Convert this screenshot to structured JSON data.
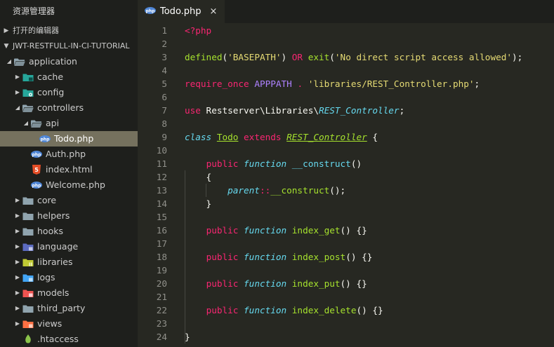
{
  "sidebar": {
    "header": "资源管理器",
    "open_editors": "打开的编辑器",
    "project": "JWT-RESTFULL-IN-CI-TUTORIAL",
    "tree": [
      {
        "label": "application",
        "depth": 1,
        "chevron": "down",
        "icon": "folder-open-icon"
      },
      {
        "label": "cache",
        "depth": 2,
        "chevron": "right",
        "icon": "folder-cache-icon"
      },
      {
        "label": "config",
        "depth": 2,
        "chevron": "right",
        "icon": "folder-config-icon"
      },
      {
        "label": "controllers",
        "depth": 2,
        "chevron": "down",
        "icon": "folder-open-icon"
      },
      {
        "label": "api",
        "depth": 3,
        "chevron": "down",
        "icon": "folder-open-icon"
      },
      {
        "label": "Todo.php",
        "depth": 4,
        "chevron": "none",
        "icon": "php-file-icon",
        "selected": true
      },
      {
        "label": "Auth.php",
        "depth": 3,
        "chevron": "none",
        "icon": "php-file-icon"
      },
      {
        "label": "index.html",
        "depth": 3,
        "chevron": "none",
        "icon": "html-file-icon"
      },
      {
        "label": "Welcome.php",
        "depth": 3,
        "chevron": "none",
        "icon": "php-file-icon"
      },
      {
        "label": "core",
        "depth": 2,
        "chevron": "right",
        "icon": "folder-icon"
      },
      {
        "label": "helpers",
        "depth": 2,
        "chevron": "right",
        "icon": "folder-icon"
      },
      {
        "label": "hooks",
        "depth": 2,
        "chevron": "right",
        "icon": "folder-icon"
      },
      {
        "label": "language",
        "depth": 2,
        "chevron": "right",
        "icon": "folder-language-icon"
      },
      {
        "label": "libraries",
        "depth": 2,
        "chevron": "right",
        "icon": "folder-libraries-icon"
      },
      {
        "label": "logs",
        "depth": 2,
        "chevron": "right",
        "icon": "folder-logs-icon"
      },
      {
        "label": "models",
        "depth": 2,
        "chevron": "right",
        "icon": "folder-models-icon"
      },
      {
        "label": "third_party",
        "depth": 2,
        "chevron": "right",
        "icon": "folder-icon"
      },
      {
        "label": "views",
        "depth": 2,
        "chevron": "right",
        "icon": "folder-views-icon"
      },
      {
        "label": ".htaccess",
        "depth": 2,
        "chevron": "none",
        "icon": "htaccess-file-icon"
      }
    ]
  },
  "tab": {
    "title": "Todo.php",
    "close": "×",
    "badge": "php"
  },
  "code": {
    "lines": [
      [
        [
          "kw",
          "<?php"
        ]
      ],
      [],
      [
        [
          "fn",
          "defined"
        ],
        [
          "plain",
          "("
        ],
        [
          "str",
          "'BASEPATH'"
        ],
        [
          "plain",
          ") "
        ],
        [
          "kw",
          "OR"
        ],
        [
          "plain",
          " "
        ],
        [
          "fn",
          "exit"
        ],
        [
          "plain",
          "("
        ],
        [
          "str",
          "'No direct script access allowed'"
        ],
        [
          "plain",
          ");"
        ]
      ],
      [],
      [
        [
          "kw",
          "require_once"
        ],
        [
          "plain",
          " "
        ],
        [
          "const",
          "APPPATH"
        ],
        [
          "plain",
          " "
        ],
        [
          "kw",
          "."
        ],
        [
          "plain",
          " "
        ],
        [
          "str",
          "'libraries/REST_Controller.php'"
        ],
        [
          "plain",
          ";"
        ]
      ],
      [],
      [
        [
          "kw",
          "use"
        ],
        [
          "plain",
          " Restserver\\Libraries\\"
        ],
        [
          "storage",
          "REST_Controller"
        ],
        [
          "plain",
          ";"
        ]
      ],
      [],
      [
        [
          "storage",
          "class"
        ],
        [
          "plain",
          " "
        ],
        [
          "cls",
          "Todo"
        ],
        [
          "plain",
          " "
        ],
        [
          "kw",
          "extends"
        ],
        [
          "plain",
          " "
        ],
        [
          "inh",
          "REST_Controller"
        ],
        [
          "plain",
          " {"
        ]
      ],
      [],
      [
        [
          "plain",
          "    "
        ],
        [
          "kw",
          "public"
        ],
        [
          "plain",
          " "
        ],
        [
          "storage",
          "function"
        ],
        [
          "plain",
          " "
        ],
        [
          "sup",
          "__construct"
        ],
        [
          "plain",
          "()"
        ]
      ],
      [
        [
          "plain",
          "    {"
        ]
      ],
      [
        [
          "plain",
          "        "
        ],
        [
          "storage",
          "parent"
        ],
        [
          "op",
          "::"
        ],
        [
          "fn",
          "__construct"
        ],
        [
          "plain",
          "();"
        ]
      ],
      [
        [
          "plain",
          "    }"
        ]
      ],
      [],
      [
        [
          "plain",
          "    "
        ],
        [
          "kw",
          "public"
        ],
        [
          "plain",
          " "
        ],
        [
          "storage",
          "function"
        ],
        [
          "plain",
          " "
        ],
        [
          "fn",
          "index_get"
        ],
        [
          "plain",
          "() {}"
        ]
      ],
      [],
      [
        [
          "plain",
          "    "
        ],
        [
          "kw",
          "public"
        ],
        [
          "plain",
          " "
        ],
        [
          "storage",
          "function"
        ],
        [
          "plain",
          " "
        ],
        [
          "fn",
          "index_post"
        ],
        [
          "plain",
          "() {}"
        ]
      ],
      [],
      [
        [
          "plain",
          "    "
        ],
        [
          "kw",
          "public"
        ],
        [
          "plain",
          " "
        ],
        [
          "storage",
          "function"
        ],
        [
          "plain",
          " "
        ],
        [
          "fn",
          "index_put"
        ],
        [
          "plain",
          "() {}"
        ]
      ],
      [],
      [
        [
          "plain",
          "    "
        ],
        [
          "kw",
          "public"
        ],
        [
          "plain",
          " "
        ],
        [
          "storage",
          "function"
        ],
        [
          "plain",
          " "
        ],
        [
          "fn",
          "index_delete"
        ],
        [
          "plain",
          "() {}"
        ]
      ],
      [],
      [
        [
          "plain",
          "}"
        ]
      ]
    ]
  },
  "colors": {
    "editor_bg": "#272822",
    "sidebar_bg": "#1e1f1c",
    "selection": "#75715e",
    "keyword": "#f92672",
    "function": "#a6e22e",
    "string": "#e6db74",
    "constant": "#ae81ff",
    "storage": "#66d9ef"
  }
}
